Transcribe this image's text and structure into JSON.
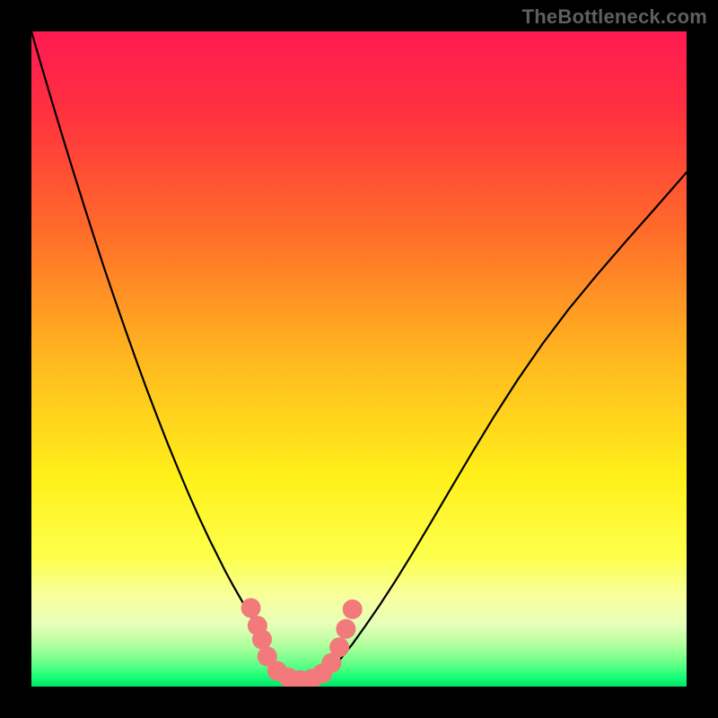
{
  "watermark": {
    "text": "TheBottleneck.com"
  },
  "chart_data": {
    "type": "line",
    "title": "",
    "xlabel": "",
    "ylabel": "",
    "xlim": [
      0,
      1
    ],
    "ylim": [
      0,
      1
    ],
    "grid": false,
    "legend": false,
    "gradient_stops": [
      {
        "offset": 0.0,
        "color": "#ff1a52"
      },
      {
        "offset": 0.12,
        "color": "#ff3040"
      },
      {
        "offset": 0.3,
        "color": "#ff6a2a"
      },
      {
        "offset": 0.5,
        "color": "#ffb81f"
      },
      {
        "offset": 0.68,
        "color": "#fff01a"
      },
      {
        "offset": 0.8,
        "color": "#fdff4a"
      },
      {
        "offset": 0.865,
        "color": "#f7ffa0"
      },
      {
        "offset": 0.905,
        "color": "#e6ffb8"
      },
      {
        "offset": 0.935,
        "color": "#b6ffa0"
      },
      {
        "offset": 0.965,
        "color": "#66ff88"
      },
      {
        "offset": 0.985,
        "color": "#1aff77"
      },
      {
        "offset": 1.0,
        "color": "#00e46a"
      }
    ],
    "series": [
      {
        "name": "curve-left",
        "x": [
          0.0,
          0.016,
          0.032,
          0.048,
          0.064,
          0.08,
          0.096,
          0.112,
          0.128,
          0.144,
          0.16,
          0.176,
          0.192,
          0.208,
          0.224,
          0.24,
          0.256,
          0.272,
          0.284,
          0.296,
          0.308,
          0.32,
          0.332,
          0.344,
          0.355
        ],
        "y": [
          1.0,
          0.945,
          0.891,
          0.838,
          0.786,
          0.735,
          0.685,
          0.636,
          0.589,
          0.543,
          0.498,
          0.454,
          0.412,
          0.371,
          0.332,
          0.294,
          0.258,
          0.224,
          0.2,
          0.176,
          0.154,
          0.133,
          0.112,
          0.092,
          0.073
        ]
      },
      {
        "name": "curve-flat",
        "x": [
          0.355,
          0.37,
          0.39,
          0.41,
          0.43,
          0.45
        ],
        "y": [
          0.06,
          0.032,
          0.015,
          0.01,
          0.012,
          0.02
        ]
      },
      {
        "name": "curve-right",
        "x": [
          0.45,
          0.47,
          0.49,
          0.51,
          0.532,
          0.556,
          0.582,
          0.61,
          0.64,
          0.672,
          0.706,
          0.742,
          0.78,
          0.82,
          0.862,
          0.906,
          0.952,
          1.0
        ],
        "y": [
          0.02,
          0.04,
          0.065,
          0.093,
          0.125,
          0.162,
          0.204,
          0.251,
          0.302,
          0.356,
          0.412,
          0.468,
          0.523,
          0.576,
          0.627,
          0.678,
          0.73,
          0.785
        ]
      }
    ],
    "marker_points": {
      "comment": "approximate salmon/pink dots near the valley",
      "color": "#f27a7a",
      "radius_px": 11,
      "points": [
        {
          "x": 0.335,
          "y": 0.12
        },
        {
          "x": 0.345,
          "y": 0.093
        },
        {
          "x": 0.352,
          "y": 0.072
        },
        {
          "x": 0.36,
          "y": 0.046
        },
        {
          "x": 0.375,
          "y": 0.024
        },
        {
          "x": 0.392,
          "y": 0.014
        },
        {
          "x": 0.41,
          "y": 0.01
        },
        {
          "x": 0.428,
          "y": 0.012
        },
        {
          "x": 0.444,
          "y": 0.02
        },
        {
          "x": 0.458,
          "y": 0.036
        },
        {
          "x": 0.47,
          "y": 0.06
        },
        {
          "x": 0.48,
          "y": 0.088
        },
        {
          "x": 0.49,
          "y": 0.118
        }
      ]
    }
  }
}
